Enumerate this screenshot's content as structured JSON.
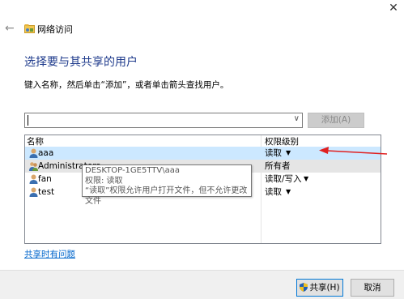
{
  "window": {
    "title": "网络访问",
    "close_glyph": "✕",
    "back_glyph": "←"
  },
  "heading": "选择要与其共享的用户",
  "instruction": "键入名称，然后单击“添加”，或者单击箭头查找用户。",
  "input": {
    "value": "",
    "dropdown_glyph": "∨"
  },
  "add_button": "添加(A)",
  "table": {
    "headers": [
      "名称",
      "权限级别"
    ],
    "rows": [
      {
        "name": "aaa",
        "permission": "读取",
        "has_dropdown": true,
        "state": "selected"
      },
      {
        "name": "Administrators",
        "permission": "所有者",
        "has_dropdown": false,
        "state": "hover"
      },
      {
        "name": "fan",
        "permission": "读取/写入",
        "has_dropdown": true,
        "state": "normal"
      },
      {
        "name": "test",
        "permission": "读取",
        "has_dropdown": true,
        "state": "normal"
      }
    ],
    "dropdown_glyph": "▼"
  },
  "tooltip": {
    "line1": "DESKTOP-1GE5TTV\\aaa",
    "line2": "权限: 读取",
    "line3": "“读取”权限允许用户打开文件，但不允许更改文件"
  },
  "trouble_link": "共享时有问题",
  "buttons": {
    "share": "共享(H)",
    "cancel": "取消"
  },
  "colors": {
    "heading": "#1f3b8c",
    "selected_row": "#cce8ff",
    "link": "#0066cc",
    "annotation_arrow": "#e02020",
    "focus_border": "#0078d7"
  }
}
